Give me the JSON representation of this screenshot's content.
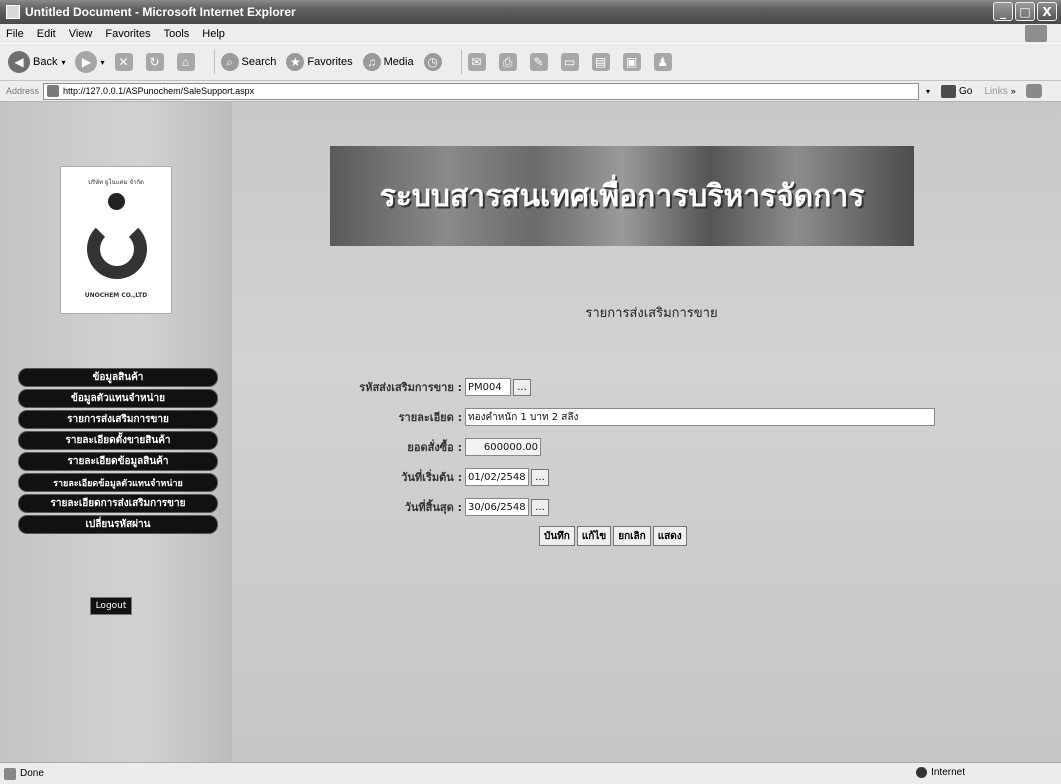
{
  "window": {
    "title": "Untitled Document - Microsoft Internet Explorer",
    "buttons": [
      "_",
      "□",
      "X"
    ]
  },
  "menubar": [
    "File",
    "Edit",
    "View",
    "Favorites",
    "Tools",
    "Help"
  ],
  "toolbar": {
    "back": "Back",
    "search": "Search",
    "favorites": "Favorites",
    "media": "Media"
  },
  "address": {
    "label": "Address",
    "url": "http://127.0.0.1/ASPunochem/SaleSupport.aspx",
    "go": "Go",
    "links": "Links"
  },
  "logo": {
    "top_text": "บริษัท ยูโนแคม จำกัด",
    "bottom_text": "UNOCHEM CO.,LTD"
  },
  "banner": {
    "title": "ระบบสารสนเทศเพื่อการบริหารจัดการ"
  },
  "sidebar": {
    "items": [
      {
        "label": "ข้อมูลสินค้า"
      },
      {
        "label": "ข้อมูลตัวแทนจำหน่าย"
      },
      {
        "label": "รายการส่งเสริมการขาย"
      },
      {
        "label": "รายละเอียดตั้งขายสินค้า"
      },
      {
        "label": "รายละเอียดข้อมูลสินค้า"
      },
      {
        "label": "รายละเอียดข้อมูลตัวแทนจำหน่าย"
      },
      {
        "label": "รายละเอียดการส่งเสริมการขาย"
      },
      {
        "label": "เปลี่ยนรหัสผ่าน"
      }
    ],
    "logout": "Logout"
  },
  "main": {
    "heading": "รายการส่งเสริมการขาย",
    "form": {
      "code": {
        "label": "รหัสส่งเสริมการขาย :",
        "value": "PM004"
      },
      "detail": {
        "label": "รายละเอียด :",
        "value": "ทองคำหนัก 1 บาท 2 สลึง"
      },
      "amount": {
        "label": "ยอดสั่งซื้อ :",
        "value": "600000.00"
      },
      "start_date": {
        "label": "วันที่เริ่มต้น :",
        "value": "01/02/2548"
      },
      "end_date": {
        "label": "วันที่สิ้นสุด :",
        "value": "30/06/2548"
      }
    },
    "buttons": {
      "save": "บันทึก",
      "edit": "แก้ไข",
      "cancel": "ยกเลิก",
      "show": "แสดง"
    },
    "dots": "..."
  },
  "statusbar": {
    "status": "Done",
    "zone": "Internet"
  }
}
